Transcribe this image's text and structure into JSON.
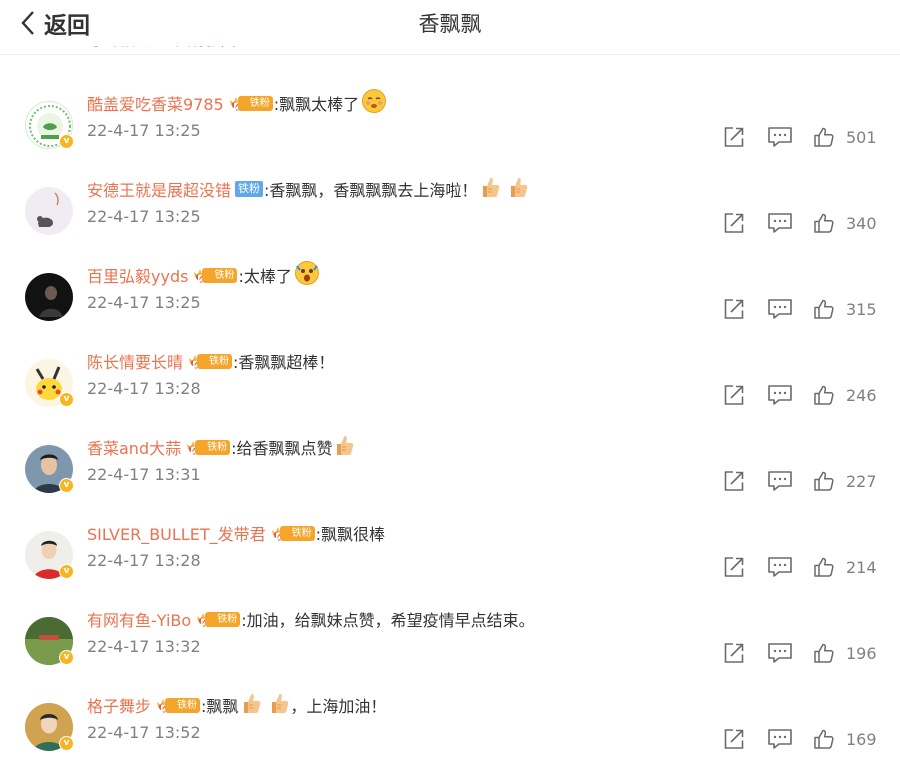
{
  "header": {
    "back_label": "返回",
    "title": "香飘飘",
    "peek_text_1": "小叶被飞人",
    "peek_text_2": "只有张国显"
  },
  "colors": {
    "username": "#eb7350",
    "gold_tag": "#f5a62a",
    "blue_tag": "#61a8ea",
    "verified": "#f7b524",
    "meta_text": "#808080"
  },
  "comments": [
    {
      "username": "酷盖爱吃香菜9785",
      "fan_label": "铁粉",
      "fan_style": "gold",
      "text": ":飘飘太棒了",
      "emoji": "blushing-face",
      "time": "22-4-17 13:25",
      "likes": "501",
      "verified": true,
      "avatar": "green-badge-avatar"
    },
    {
      "username": "安德王就是展超没错",
      "fan_label": "铁粉",
      "fan_style": "blue",
      "text": ":香飘飘，香飘飘飘去上海啦！",
      "emoji": "thumbs-up x2",
      "time": "22-4-17 13:25",
      "likes": "340",
      "verified": false,
      "avatar": "cat-sketch-avatar"
    },
    {
      "username": "百里弘毅yyds",
      "fan_label": "铁粉",
      "fan_style": "gold",
      "text": ":太棒了",
      "emoji": "shocked-face",
      "time": "22-4-17 13:25",
      "likes": "315",
      "verified": false,
      "avatar": "dark-photo-avatar"
    },
    {
      "username": "陈长情要长晴",
      "fan_label": "铁粉",
      "fan_style": "gold",
      "text": ":香飘飘超棒！",
      "emoji": "",
      "time": "22-4-17 13:28",
      "likes": "246",
      "verified": true,
      "avatar": "pikachu-avatar"
    },
    {
      "username": "香菜and大蒜",
      "fan_label": "铁粉",
      "fan_style": "gold",
      "text": ":给香飘飘点赞",
      "emoji": "thumbs-up",
      "time": "22-4-17 13:31",
      "likes": "227",
      "verified": true,
      "avatar": "portrait-avatar"
    },
    {
      "username": "SILVER_BULLET_发带君",
      "fan_label": "铁粉",
      "fan_style": "gold",
      "text": ":飘飘很棒",
      "emoji": "",
      "time": "22-4-17 13:28",
      "likes": "214",
      "verified": true,
      "avatar": "red-shirt-avatar"
    },
    {
      "username": "有网有鱼-YiBo",
      "fan_label": "铁粉",
      "fan_style": "gold",
      "text": ":加油，给飘妹点赞，希望疫情早点结束。",
      "emoji": "",
      "time": "22-4-17 13:32",
      "likes": "196",
      "verified": true,
      "avatar": "field-avatar"
    },
    {
      "username": "格子舞步",
      "fan_label": "铁粉",
      "fan_style": "gold",
      "text": ":飘飘",
      "emoji": "thumbs-up x2",
      "text_after": "，上海加油！",
      "time": "22-4-17 13:52",
      "likes": "169",
      "verified": true,
      "avatar": "boy-avatar"
    }
  ]
}
